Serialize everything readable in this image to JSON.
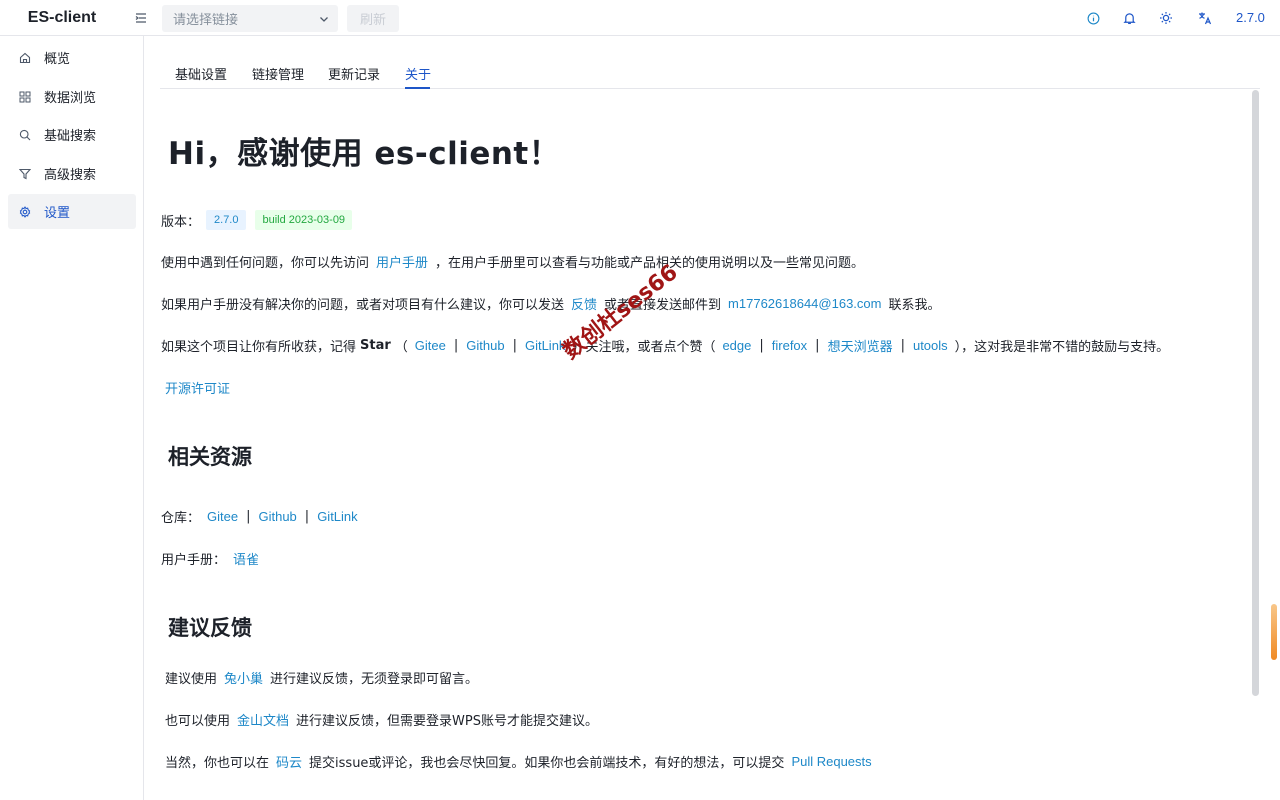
{
  "header": {
    "brand": "ES-client",
    "select_placeholder": "请选择链接",
    "refresh_label": "刷新",
    "version": "2.7.0"
  },
  "sidebar": {
    "items": [
      {
        "label": "概览",
        "icon": "home-icon"
      },
      {
        "label": "数据浏览",
        "icon": "grid-icon"
      },
      {
        "label": "基础搜索",
        "icon": "search-icon"
      },
      {
        "label": "高级搜索",
        "icon": "filter-icon"
      },
      {
        "label": "设置",
        "icon": "gear-icon"
      }
    ],
    "active_index": 4
  },
  "tabs": [
    {
      "label": "基础设置"
    },
    {
      "label": "链接管理"
    },
    {
      "label": "更新记录"
    },
    {
      "label": "关于"
    }
  ],
  "about": {
    "title": "Hi，感谢使用 es-client！",
    "version_label": "版本：",
    "version_tag": "2.7.0",
    "build_tag": "build 2023-03-09",
    "p1": {
      "pre": "使用中遇到任何问题，你可以先访问",
      "link": "用户手册",
      "post": "，在用户手册里可以查看与功能或产品相关的使用说明以及一些常见问题。"
    },
    "p2": {
      "pre": "如果用户手册没有解决你的问题，或者对项目有什么建议，你可以发送",
      "link1": "反馈",
      "mid": "或者直接发送邮件到",
      "email": "m17762618644@163.com",
      "post": "联系我。"
    },
    "p3": {
      "pre": "如果这个项目让你有所收获，记得",
      "star": "Star",
      "open_paren": "（",
      "gitee": "Gitee",
      "github": "Github",
      "gitlink": "GitLink",
      "mid": "）关注哦，或者点个赞（",
      "edge": "edge",
      "firefox": "firefox",
      "xiangtian": "想天浏览器",
      "utools": "utools",
      "post": "），这对我是非常不错的鼓励与支持。",
      "sep": "|"
    },
    "license": "开源许可证",
    "resources_title": "相关资源",
    "repo_label": "仓库：",
    "repo_gitee": "Gitee",
    "repo_github": "Github",
    "repo_gitlink": "GitLink",
    "manual_label": "用户手册：",
    "manual_link": "语雀",
    "feedback_title": "建议反馈",
    "fb1": {
      "pre": "建议使用",
      "link": "兔小巢",
      "post": "进行建议反馈，无须登录即可留言。"
    },
    "fb2": {
      "pre": "也可以使用",
      "link": "金山文档",
      "post": "进行建议反馈，但需要登录WPS账号才能提交建议。"
    },
    "fb3": {
      "pre": "当然，你也可以在",
      "link": "码云",
      "mid": "提交issue或评论，我也会尽快回复。如果你也会前端技术，有好的想法，可以提交",
      "link2": "Pull Requests"
    }
  },
  "watermark": "数创杜ses66",
  "colors": {
    "accent": "#1e56c8",
    "link": "#1e88c8",
    "tag_blue_bg": "#e8f3ff",
    "tag_green_bg": "#e8ffea",
    "tag_green_fg": "#23a840"
  }
}
